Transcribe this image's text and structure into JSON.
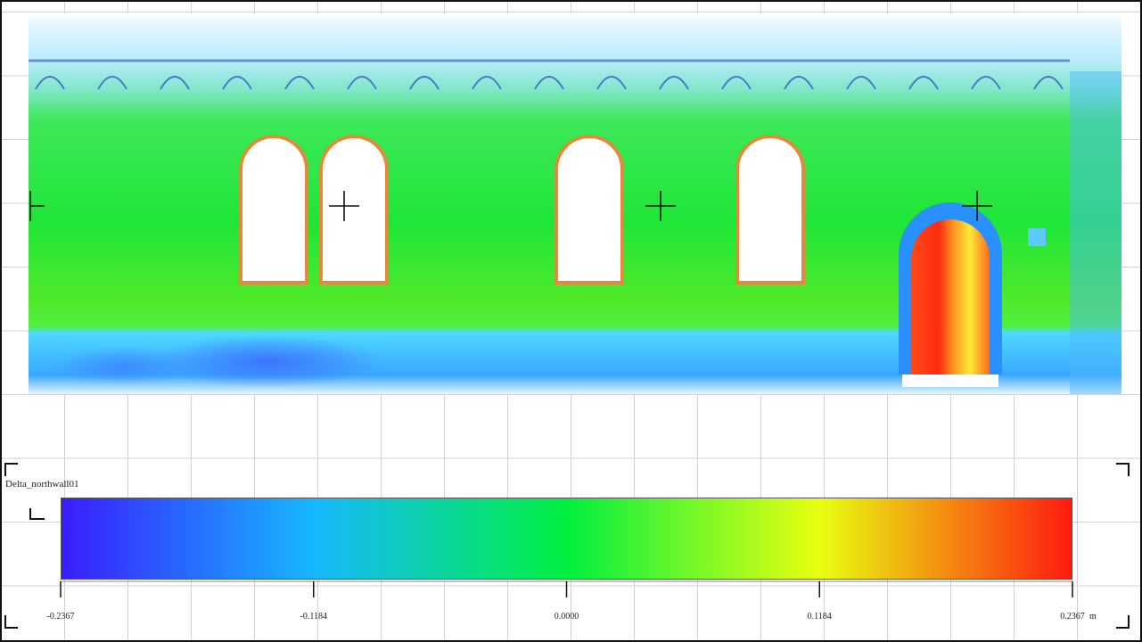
{
  "legend": {
    "title": "Delta_northwall01",
    "unit": "m",
    "min": -0.2367,
    "max": 0.2367,
    "ticks": [
      "-0.2367",
      "-0.1184",
      "0.0000",
      "0.1184",
      "0.2367"
    ],
    "gradient": [
      "#3a1cff",
      "#16b8ff",
      "#00f040",
      "#e8ff10",
      "#ff1a10"
    ]
  },
  "scene": {
    "description_colors": {
      "wall_green": "#2bea2e",
      "upper_light": "#c8f0ff",
      "base_cyan": "#38d8ff",
      "door_red": "#ff3c1e",
      "window_outline": "#e08a3a"
    },
    "crosshair_icon": "crosshair-icon",
    "corner_icon": "corner-bracket-icon"
  }
}
